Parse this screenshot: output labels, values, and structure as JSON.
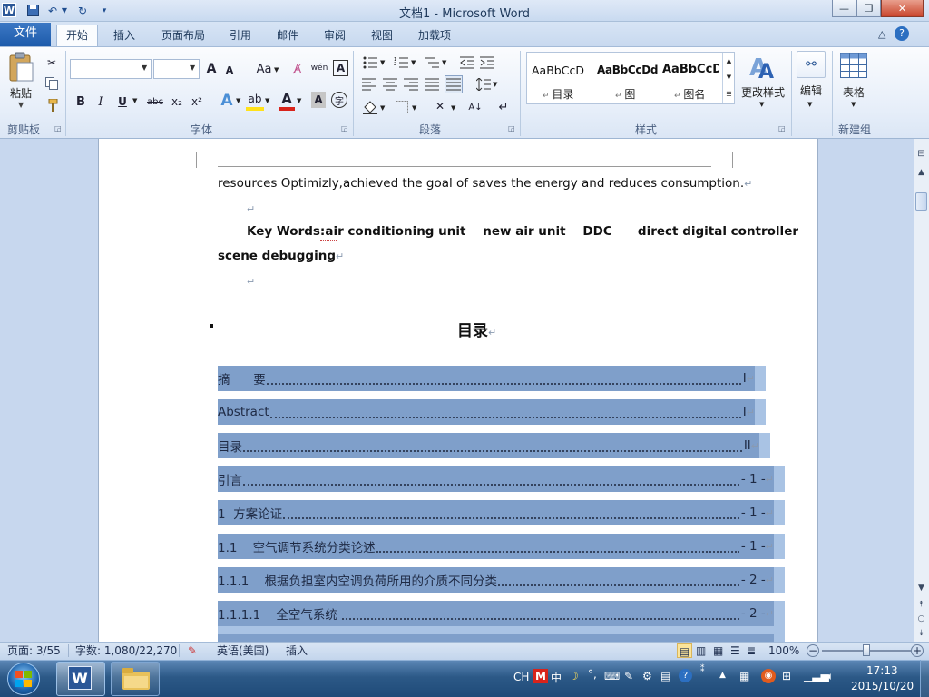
{
  "window": {
    "title": "文档1 - Microsoft Word"
  },
  "tabs": {
    "file": "文件",
    "home": "开始",
    "insert": "插入",
    "page_layout": "页面布局",
    "references": "引用",
    "mailings": "邮件",
    "review": "审阅",
    "view": "视图",
    "addins": "加载项"
  },
  "ribbon": {
    "clipboard": {
      "paste": "粘贴",
      "label": "剪贴板"
    },
    "font": {
      "label": "字体",
      "grow": "A",
      "shrink": "A",
      "aa": "Aa",
      "wen": "wén",
      "bold": "B",
      "italic": "I",
      "underline": "U",
      "strike": "abc",
      "sub": "x₂",
      "sup": "x²"
    },
    "paragraph": {
      "label": "段落"
    },
    "styles": {
      "label": "样式",
      "style1_preview": "AaBbCcD",
      "style1_name": "目录",
      "style2_preview": "AaBbCcDd",
      "style2_name": "图",
      "style3_preview": "AaBbCcD",
      "style3_name": "图名",
      "change_styles": "更改样式"
    },
    "editing": {
      "label": "编辑"
    },
    "table": {
      "button": "表格",
      "label": "新建组"
    }
  },
  "document": {
    "abstract_tail": "resources Optimizly,achieved the goal of saves the energy and reduces consumption.",
    "keywords_label": "Key Words:",
    "keywords_line1": "air conditioning unit    new air unit    DDC      direct digital controller",
    "keywords_line2": "scene debugging",
    "toc_title": "目录",
    "toc": [
      {
        "text": "摘      要",
        "page": "I"
      },
      {
        "text": "Abstract",
        "page": "I"
      },
      {
        "text": "目录",
        "page": "II"
      },
      {
        "text": "引言",
        "page": "- 1 -"
      },
      {
        "text": "1  方案论证",
        "page": "- 1 -"
      },
      {
        "text": "1.1    空气调节系统分类论述",
        "page": "- 1 -"
      },
      {
        "text": "1.1.1    根据负担室内空调负荷所用的介质不同分类",
        "page": "- 2 -"
      },
      {
        "text": "1.1.1.1    全空气系统 ",
        "page": "- 2 -"
      }
    ]
  },
  "status": {
    "page": "页面: 3/55",
    "words": "字数: 1,080/22,270",
    "language": "英语(美国)",
    "mode": "插入",
    "zoom": "100%",
    "zoom_percent": 100
  },
  "taskbar": {
    "ime": "CH",
    "ime_zh": "中",
    "time": "17:13",
    "date": "2015/10/20"
  },
  "colors": {
    "selection": "#7f9fca",
    "file_tab": "#1d5bab",
    "page": "#ffffff"
  }
}
